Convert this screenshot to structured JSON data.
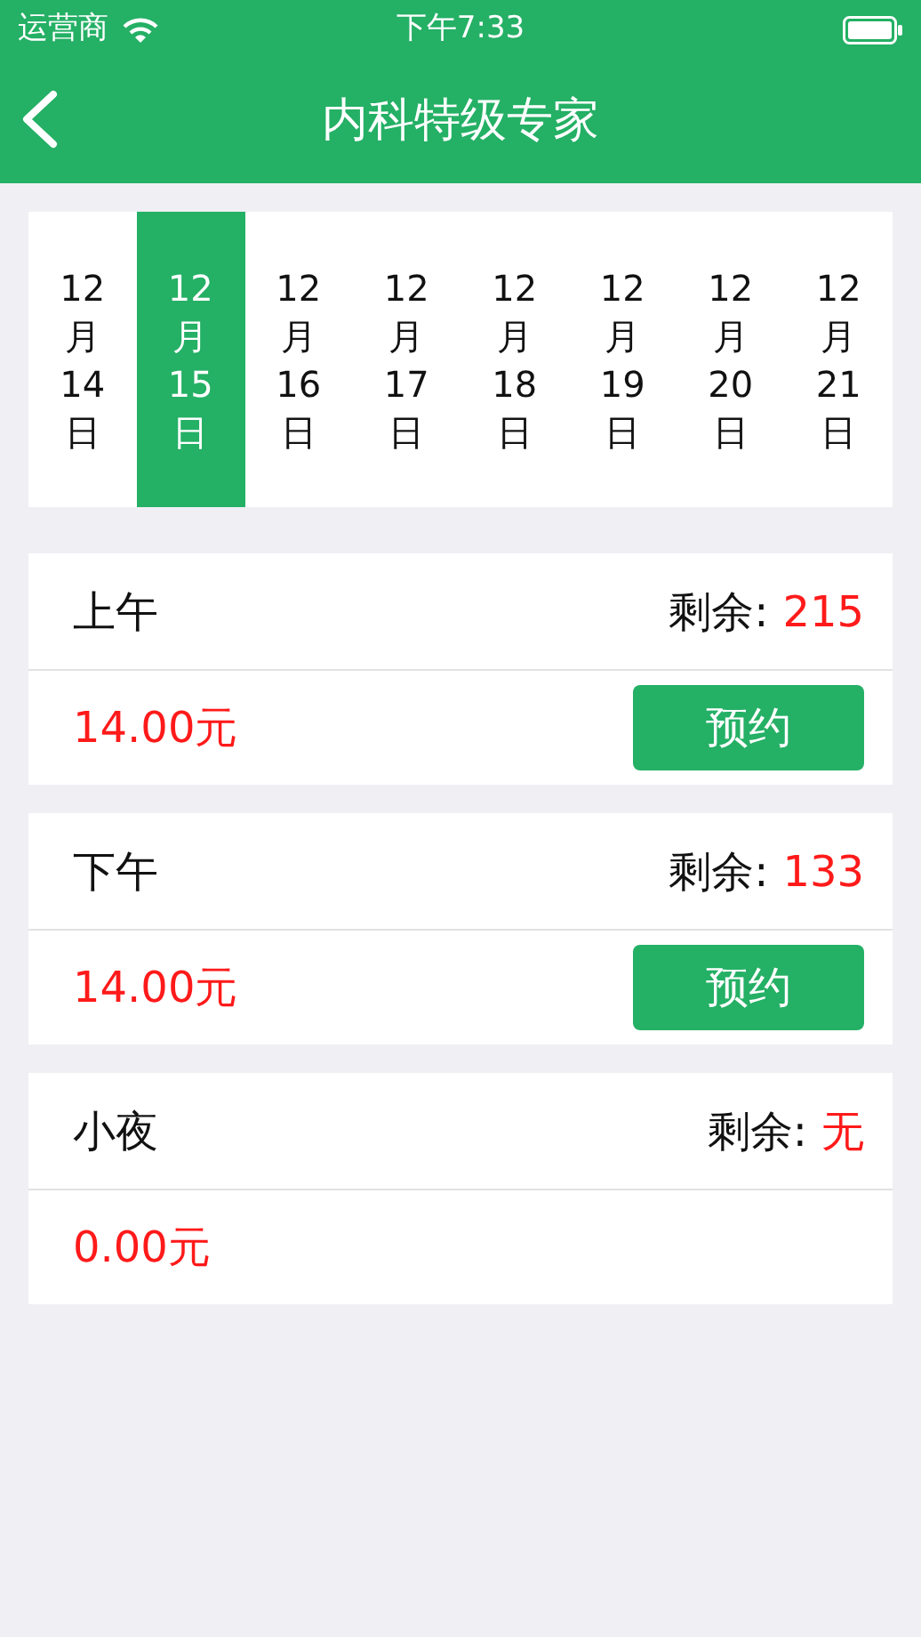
{
  "status_bar": {
    "carrier": "运营商",
    "time": "下午7:33"
  },
  "nav": {
    "title": "内科特级专家"
  },
  "dates": [
    {
      "month": "12",
      "month_unit": "月",
      "day": "14",
      "day_unit": "日",
      "selected": false
    },
    {
      "month": "12",
      "month_unit": "月",
      "day": "15",
      "day_unit": "日",
      "selected": true
    },
    {
      "month": "12",
      "month_unit": "月",
      "day": "16",
      "day_unit": "日",
      "selected": false
    },
    {
      "month": "12",
      "month_unit": "月",
      "day": "17",
      "day_unit": "日",
      "selected": false
    },
    {
      "month": "12",
      "month_unit": "月",
      "day": "18",
      "day_unit": "日",
      "selected": false
    },
    {
      "month": "12",
      "month_unit": "月",
      "day": "19",
      "day_unit": "日",
      "selected": false
    },
    {
      "month": "12",
      "month_unit": "月",
      "day": "20",
      "day_unit": "日",
      "selected": false
    },
    {
      "month": "12",
      "month_unit": "月",
      "day": "21",
      "day_unit": "日",
      "selected": false
    }
  ],
  "sessions": [
    {
      "name": "上午",
      "remaining_label": "剩余:",
      "remaining": "215",
      "price": "14.00元",
      "button": "预约"
    },
    {
      "name": "下午",
      "remaining_label": "剩余:",
      "remaining": "133",
      "price": "14.00元",
      "button": "预约"
    },
    {
      "name": "小夜",
      "remaining_label": "剩余:",
      "remaining": "无",
      "price": "0.00元"
    }
  ]
}
